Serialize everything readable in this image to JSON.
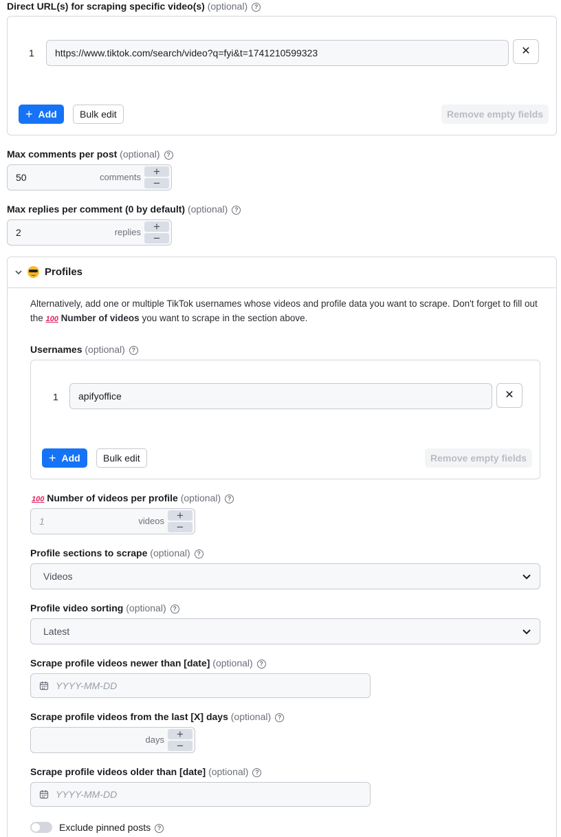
{
  "urls": {
    "label": "Direct URL(s) for scraping specific video(s)",
    "optional": "(optional)",
    "items": [
      {
        "num": "1",
        "value": "https://www.tiktok.com/search/video?q=fyi&t=1741210599323"
      }
    ],
    "add_label": "Add",
    "bulk_label": "Bulk edit",
    "remove_label": "Remove empty fields"
  },
  "max_comments": {
    "label": "Max comments per post",
    "optional": "(optional)",
    "value": "50",
    "unit": "comments"
  },
  "max_replies": {
    "label": "Max replies per comment (0 by default)",
    "optional": "(optional)",
    "value": "2",
    "unit": "replies"
  },
  "profiles": {
    "title": "Profiles",
    "desc_part1": "Alternatively, add one or multiple TikTok usernames whose videos and profile data you want to scrape. Don't forget to fill out the",
    "desc_emoji": "100",
    "desc_bold": "Number of videos",
    "desc_part2": "you want to scrape in the section above.",
    "usernames": {
      "label": "Usernames",
      "optional": "(optional)",
      "items": [
        {
          "num": "1",
          "value": "apifyoffice"
        }
      ],
      "add_label": "Add",
      "bulk_label": "Bulk edit",
      "remove_label": "Remove empty fields"
    },
    "videos_per_profile": {
      "emoji": "100",
      "label": "Number of videos per profile",
      "optional": "(optional)",
      "placeholder": "1",
      "unit": "videos"
    },
    "sections": {
      "label": "Profile sections to scrape",
      "optional": "(optional)",
      "value": "Videos"
    },
    "sorting": {
      "label": "Profile video sorting",
      "optional": "(optional)",
      "value": "Latest"
    },
    "newer_than": {
      "label": "Scrape profile videos newer than [date]",
      "optional": "(optional)",
      "placeholder": "YYYY-MM-DD"
    },
    "last_days": {
      "label": "Scrape profile videos from the last [X] days",
      "optional": "(optional)",
      "unit": "days"
    },
    "older_than": {
      "label": "Scrape profile videos older than [date]",
      "optional": "(optional)",
      "placeholder": "YYYY-MM-DD"
    },
    "exclude_pinned": {
      "label": "Exclude pinned posts",
      "enabled": false
    }
  },
  "colors": {
    "primary": "#1673f5",
    "border": "#d6d8de",
    "muted": "#6b6f78"
  },
  "icons": {
    "help": "question-circle-icon",
    "close": "x-icon",
    "plus": "plus-icon",
    "minus": "minus-icon",
    "chevron": "chevron-down-icon",
    "calendar": "calendar-icon"
  }
}
